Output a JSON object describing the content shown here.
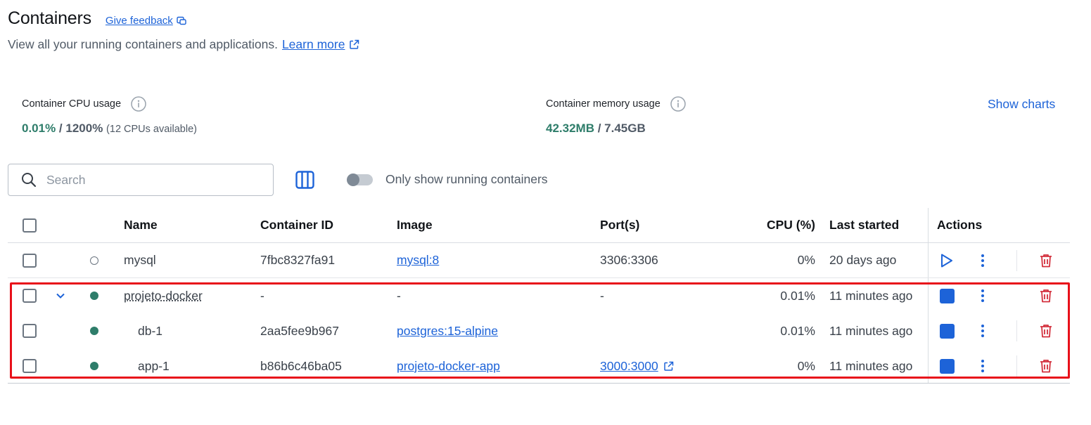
{
  "header": {
    "title": "Containers",
    "feedback_label": "Give feedback",
    "subtitle": "View all your running containers and applications.",
    "learn_more": "Learn more"
  },
  "stats": {
    "cpu": {
      "label": "Container CPU usage",
      "used": "0.01%",
      "sep": " / ",
      "total": "1200%",
      "note": "(12 CPUs available)"
    },
    "memory": {
      "label": "Container memory usage",
      "used": "42.32MB",
      "sep": " / ",
      "total": "7.45GB"
    },
    "show_charts": "Show charts"
  },
  "toolbar": {
    "search_placeholder": "Search",
    "toggle_label": "Only show running containers",
    "toggle_on": false
  },
  "table": {
    "columns": {
      "name": "Name",
      "id": "Container ID",
      "image": "Image",
      "ports": "Port(s)",
      "cpu": "CPU (%)",
      "last": "Last started",
      "actions": "Actions"
    },
    "rows": [
      {
        "name": "mysql",
        "id": "7fbc8327fa91",
        "image": "mysql:8",
        "ports": "3306:3306",
        "cpu": "0%",
        "last": "20 days ago",
        "status": "stopped"
      },
      {
        "name": "projeto-docker",
        "id": "-",
        "image": "-",
        "ports": "-",
        "cpu": "0.01%",
        "last": "11 minutes ago",
        "status": "running",
        "expanded": true
      },
      {
        "name": "db-1",
        "id": "2aa5fee9b967",
        "image": "postgres:15-alpine",
        "ports": "",
        "cpu": "0.01%",
        "last": "11 minutes ago",
        "status": "running"
      },
      {
        "name": "app-1",
        "id": "b86b6c46ba05",
        "image": "projeto-docker-app",
        "ports": "3000:3000",
        "cpu": "0%",
        "last": "11 minutes ago",
        "status": "running"
      }
    ]
  },
  "colors": {
    "accent": "#1d63d8",
    "running": "#2e7d6a",
    "delete": "#d32f3c",
    "highlight": "#e8101a"
  },
  "icons": [
    "external-link-icon",
    "info-icon",
    "search-icon",
    "columns-icon",
    "chevron-down-icon",
    "play-icon",
    "stop-icon",
    "more-vertical-icon",
    "trash-icon"
  ]
}
